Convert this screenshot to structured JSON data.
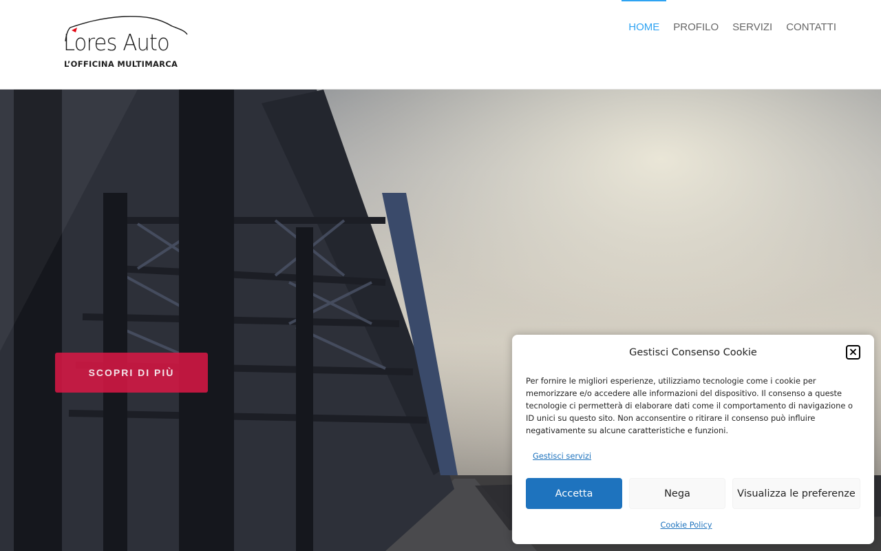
{
  "header": {
    "logo": {
      "name": "Lores Auto",
      "tagline": "L’OFFICINA MULTIMARCA",
      "accent_color": "#e30613"
    },
    "nav": [
      {
        "label": "HOME",
        "active": true
      },
      {
        "label": "PROFILO",
        "active": false
      },
      {
        "label": "SERVIZI",
        "active": false
      },
      {
        "label": "CONTATTI",
        "active": false
      }
    ],
    "nav_active_color": "#2ea3f2",
    "nav_color": "#666666"
  },
  "hero": {
    "cta_label": "SCOPRI DI PIÙ",
    "cta_color": "#d61844"
  },
  "cookie": {
    "title": "Gestisci Consenso Cookie",
    "close_icon": "close-icon",
    "message": "Per fornire le migliori esperienze, utilizziamo tecnologie come i cookie per memorizzare e/o accedere alle informazioni del dispositivo. Il consenso a queste tecnologie ci permetterà di elaborare dati come il comportamento di navigazione o ID unici su questo sito. Non acconsentire o ritirare il consenso può influire negativamente su alcune caratteristiche e funzioni.",
    "manage_services_link": "Gestisci servizi",
    "accept_label": "Accetta",
    "deny_label": "Nega",
    "preferences_label": "Visualizza le preferenze",
    "policy_link": "Cookie Policy",
    "primary_color": "#1e73be"
  }
}
